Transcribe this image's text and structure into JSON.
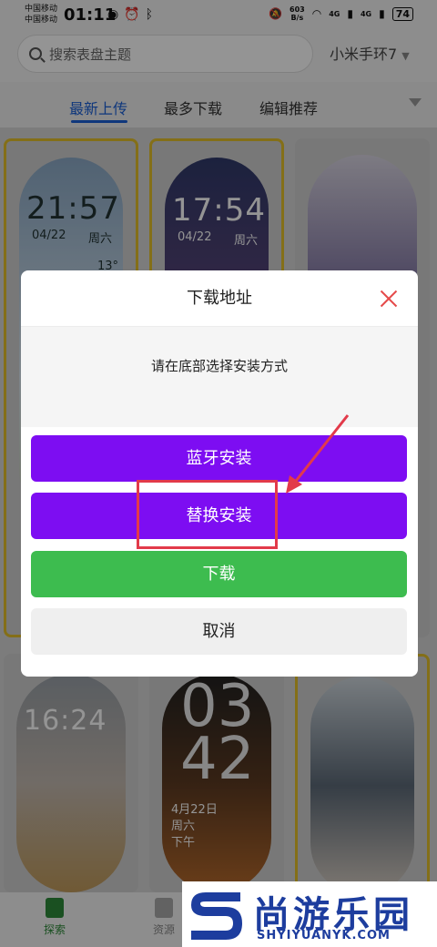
{
  "status_bar": {
    "carrier1": "中国移动",
    "carrier2": "中国移动",
    "time": "01:11",
    "net_speed_value": "603",
    "net_speed_unit": "B/s",
    "signal1": "4G",
    "signal2": "4G",
    "battery": "74"
  },
  "header": {
    "search_placeholder": "搜索表盘主题",
    "device_selector": "小米手环7"
  },
  "tabs": [
    {
      "label": "最新上传"
    },
    {
      "label": "最多下载"
    },
    {
      "label": "编辑推荐"
    }
  ],
  "cards": {
    "c1": {
      "time": "21:57",
      "date": "04/22",
      "weekday": "周六",
      "temp": "13°"
    },
    "c2": {
      "time": "17:54",
      "date": "04/22",
      "weekday": "周六"
    },
    "c4": {
      "time": "16:24"
    },
    "c5": {
      "line1": "03",
      "line2": "42",
      "date": "4月22日",
      "weekday": "周六",
      "ampm": "下午"
    }
  },
  "dialog": {
    "title": "下载地址",
    "message": "请在底部选择安装方式",
    "buttons": {
      "bluetooth": "蓝牙安装",
      "replace": "替换安装",
      "download": "下载",
      "cancel": "取消"
    }
  },
  "bottom_nav": {
    "explore": "探索",
    "resources": "资源"
  },
  "watermark": {
    "brand": "尚游乐园",
    "url": "SHYIYUANYK.COM"
  },
  "colors": {
    "accent": "#1a5fd6",
    "purple_button": "#7d0df2",
    "green_button": "#3dbc4f",
    "highlight_red": "#e23a4a"
  }
}
